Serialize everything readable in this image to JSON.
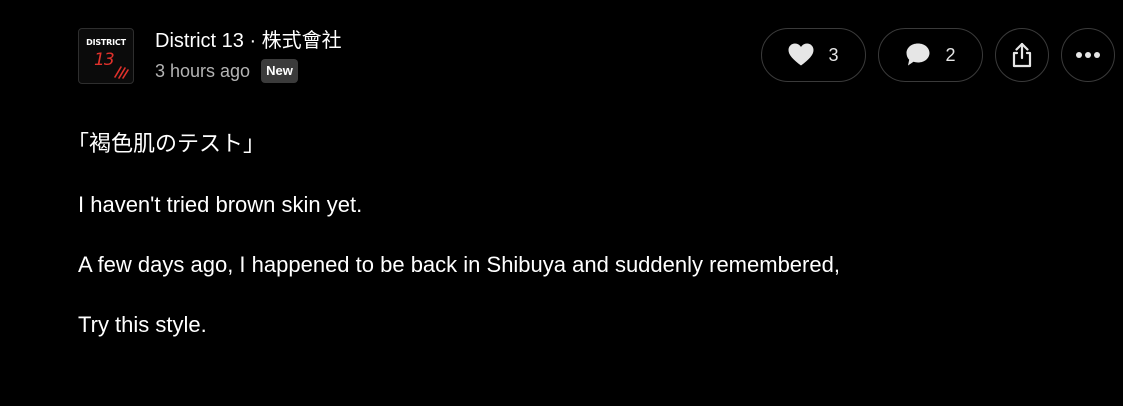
{
  "post": {
    "avatar": {
      "text": "DISTRICT",
      "number": "13"
    },
    "author": "District 13 · 株式會社",
    "timestamp": "3 hours ago",
    "badge": "New",
    "actions": {
      "like_count": "3",
      "comment_count": "2",
      "like_icon": "heart-icon",
      "comment_icon": "speech-bubble-icon",
      "share_icon": "share-icon",
      "more_icon": "ellipsis-icon"
    },
    "body": [
      "｢褐色肌のテスト｣",
      "I haven't tried brown skin yet.",
      "A few days ago, I happened to be back in Shibuya and suddenly remembered,",
      "Try this style."
    ]
  },
  "colors": {
    "background": "#000000",
    "text": "#ffffff",
    "muted": "#b3b3b3",
    "border": "#3a3a3a",
    "badge": "#3b3b3b",
    "brand_red": "#e0312b"
  }
}
